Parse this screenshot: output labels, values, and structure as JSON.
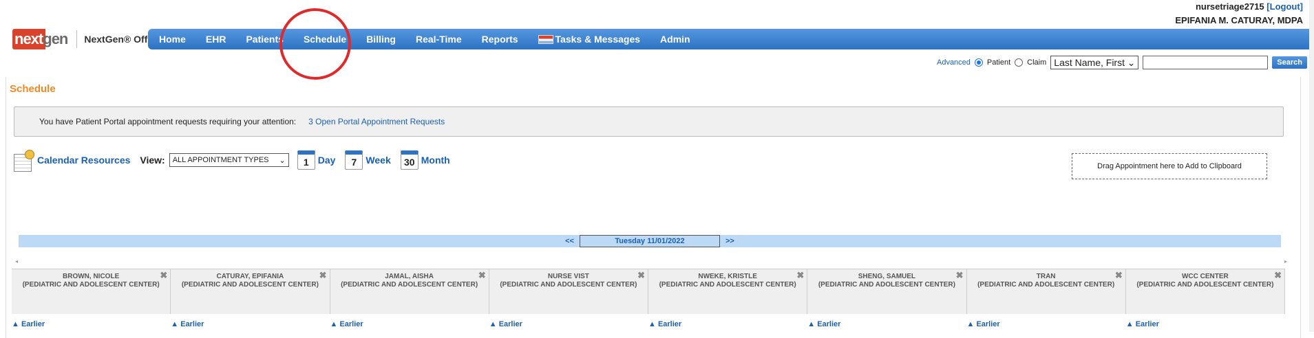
{
  "user": {
    "username": "nursetriage2715",
    "logout_label": "[Logout]",
    "full_name": "EPIFANIA M. CATURAY, MDPA"
  },
  "brand": {
    "logo_next": "next",
    "logo_gen": "gen",
    "product_name": "NextGen® Office"
  },
  "nav": {
    "home": "Home",
    "ehr": "EHR",
    "patients": "Patients",
    "schedule": "Schedule",
    "billing": "Billing",
    "realtime": "Real-Time",
    "reports": "Reports",
    "tasks": "Tasks & Messages",
    "admin": "Admin"
  },
  "search": {
    "advanced": "Advanced",
    "patient_label": "Patient",
    "claim_label": "Claim",
    "selected_type": "Patient",
    "field_value": "Last Name, First",
    "search_button": "Search"
  },
  "page": {
    "title": "Schedule"
  },
  "portal": {
    "message": "You have Patient Portal appointment requests requiring your attention:",
    "link": "3 Open Portal Appointment Requests"
  },
  "toolbar": {
    "calendar_resources": "Calendar Resources",
    "view_label": "View:",
    "view_value": "ALL APPOINTMENT TYPES",
    "day_label": "Day",
    "day_icon_num": "1",
    "week_label": "Week",
    "week_icon_num": "7",
    "month_label": "Month",
    "month_icon_num": "30"
  },
  "clipboard": {
    "text": "Drag Appointment here to Add to Clipboard"
  },
  "date_nav": {
    "prev": "<<",
    "current": "Tuesday 11/01/2022",
    "next": ">>"
  },
  "providers": [
    {
      "name": "BROWN, NICOLE",
      "location": "(PEDIATRIC AND ADOLESCENT CENTER)"
    },
    {
      "name": "CATURAY, EPIFANIA",
      "location": "(PEDIATRIC AND ADOLESCENT CENTER)"
    },
    {
      "name": "JAMAL, AISHA",
      "location": "(PEDIATRIC AND ADOLESCENT CENTER)"
    },
    {
      "name": "NURSE VIST",
      "location": "(PEDIATRIC AND ADOLESCENT CENTER)"
    },
    {
      "name": "NWEKE, KRISTLE",
      "location": "(PEDIATRIC AND ADOLESCENT CENTER)"
    },
    {
      "name": "SHENG, SAMUEL",
      "location": "(PEDIATRIC AND ADOLESCENT CENTER)"
    },
    {
      "name": "TRAN",
      "location": "(PEDIATRIC AND ADOLESCENT CENTER)"
    },
    {
      "name": "WCC CENTER",
      "location": "(PEDIATRIC AND ADOLESCENT CENTER)"
    }
  ],
  "earlier_label": "▲ Earlier",
  "icons": {
    "close": "✖",
    "scroll_left": "◂",
    "scroll_right": "▸",
    "dropdown": "⌄"
  }
}
